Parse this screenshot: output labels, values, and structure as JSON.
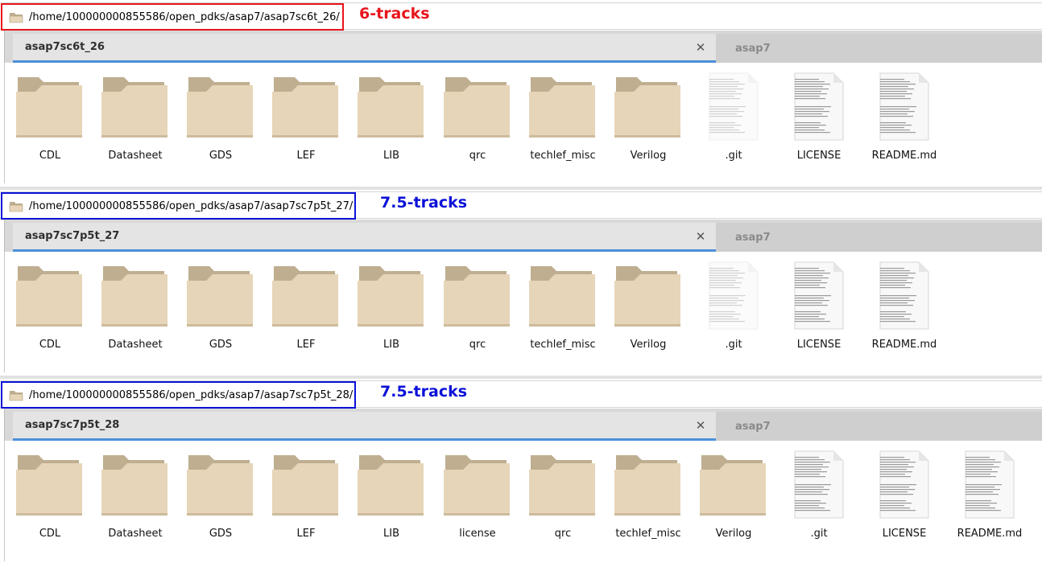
{
  "colors": {
    "annot_red": "#e8141b",
    "annot_blue": "#0b11d8",
    "tab_accent": "#4a90d9",
    "folder_back": "#bfae90",
    "folder_front": "#e6d5b8"
  },
  "sections": [
    {
      "path": "/home/100000000855586/open_pdks/asap7/asap7sc6t_26/",
      "annotation": "6-tracks",
      "annotation_color": "red",
      "active_tab": "asap7sc6t_26",
      "inactive_tab": "asap7",
      "items": [
        {
          "name": "CDL",
          "type": "folder"
        },
        {
          "name": "Datasheet",
          "type": "folder"
        },
        {
          "name": "GDS",
          "type": "folder"
        },
        {
          "name": "LEF",
          "type": "folder"
        },
        {
          "name": "LIB",
          "type": "folder"
        },
        {
          "name": "qrc",
          "type": "folder"
        },
        {
          "name": "techlef_misc",
          "type": "folder"
        },
        {
          "name": "Verilog",
          "type": "folder"
        },
        {
          "name": ".git",
          "type": "file-faded"
        },
        {
          "name": "LICENSE",
          "type": "file"
        },
        {
          "name": "README.md",
          "type": "file"
        }
      ]
    },
    {
      "path": "/home/100000000855586/open_pdks/asap7/asap7sc7p5t_27/",
      "annotation": "7.5-tracks",
      "annotation_color": "blue",
      "active_tab": "asap7sc7p5t_27",
      "inactive_tab": "asap7",
      "items": [
        {
          "name": "CDL",
          "type": "folder"
        },
        {
          "name": "Datasheet",
          "type": "folder"
        },
        {
          "name": "GDS",
          "type": "folder"
        },
        {
          "name": "LEF",
          "type": "folder"
        },
        {
          "name": "LIB",
          "type": "folder"
        },
        {
          "name": "qrc",
          "type": "folder"
        },
        {
          "name": "techlef_misc",
          "type": "folder"
        },
        {
          "name": "Verilog",
          "type": "folder"
        },
        {
          "name": ".git",
          "type": "file-faded"
        },
        {
          "name": "LICENSE",
          "type": "file"
        },
        {
          "name": "README.md",
          "type": "file"
        }
      ]
    },
    {
      "path": "/home/100000000855586/open_pdks/asap7/asap7sc7p5t_28/",
      "annotation": "7.5-tracks",
      "annotation_color": "blue",
      "active_tab": "asap7sc7p5t_28",
      "inactive_tab": "asap7",
      "items": [
        {
          "name": "CDL",
          "type": "folder"
        },
        {
          "name": "Datasheet",
          "type": "folder"
        },
        {
          "name": "GDS",
          "type": "folder"
        },
        {
          "name": "LEF",
          "type": "folder"
        },
        {
          "name": "LIB",
          "type": "folder"
        },
        {
          "name": "license",
          "type": "folder"
        },
        {
          "name": "qrc",
          "type": "folder"
        },
        {
          "name": "techlef_misc",
          "type": "folder"
        },
        {
          "name": "Verilog",
          "type": "folder"
        },
        {
          "name": ".git",
          "type": "file"
        },
        {
          "name": "LICENSE",
          "type": "file"
        },
        {
          "name": "README.md",
          "type": "file"
        }
      ]
    }
  ]
}
